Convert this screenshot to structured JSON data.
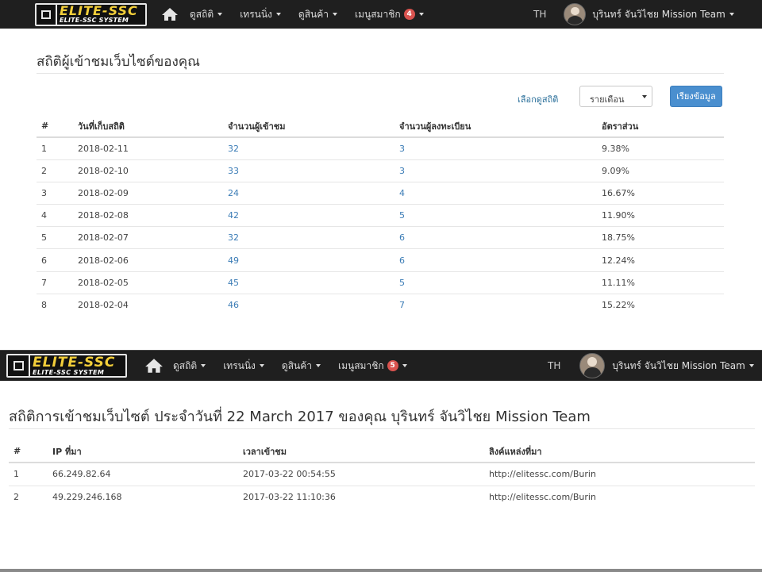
{
  "top": {
    "logo": {
      "brand": "ELITE-SSC",
      "sub": "ELITE-SSC SYSTEM"
    },
    "menu": [
      {
        "label": "ดูสถิติ"
      },
      {
        "label": "เทรนนิ่ง"
      },
      {
        "label": "ดูสินค้า"
      },
      {
        "label": "เมนูสมาชิก",
        "badge": "4"
      }
    ],
    "lang": "TH",
    "user": "บุรินทร์ จันวิไชย Mission Team"
  },
  "stats": {
    "title": "สถิติผู้เข้าชมเว็บไซต์ของคุณ",
    "filter_label": "เลือกดูสถิติ",
    "select_value": "รายเดือน",
    "button_label": "เรียงข้อมูล",
    "headers": [
      "#",
      "วันที่เก็บสถิติ",
      "จำนวนผู้เข้าชม",
      "จำนวนผู้ลงทะเบียน",
      "อัตราส่วน"
    ],
    "rows": [
      [
        "1",
        "2018-02-11",
        "32",
        "3",
        "9.38%"
      ],
      [
        "2",
        "2018-02-10",
        "33",
        "3",
        "9.09%"
      ],
      [
        "3",
        "2018-02-09",
        "24",
        "4",
        "16.67%"
      ],
      [
        "4",
        "2018-02-08",
        "42",
        "5",
        "11.90%"
      ],
      [
        "5",
        "2018-02-07",
        "32",
        "6",
        "18.75%"
      ],
      [
        "6",
        "2018-02-06",
        "49",
        "6",
        "12.24%"
      ],
      [
        "7",
        "2018-02-05",
        "45",
        "5",
        "11.11%"
      ],
      [
        "8",
        "2018-02-04",
        "46",
        "7",
        "15.22%"
      ]
    ]
  },
  "bottom": {
    "logo": {
      "brand": "ELITE-SSC",
      "sub": "ELITE-SSC SYSTEM"
    },
    "menu": [
      {
        "label": "ดูสถิติ"
      },
      {
        "label": "เทรนนิ่ง"
      },
      {
        "label": "ดูสินค้า"
      },
      {
        "label": "เมนูสมาชิก",
        "badge": "5"
      }
    ],
    "lang": "TH",
    "user": "บุรินทร์ จันวิไชย Mission Team"
  },
  "daily": {
    "title": "สถิติการเข้าชมเว็บไซต์ ประจำวันที่ 22 March 2017 ของคุณ บุรินทร์ จันวิไชย Mission Team",
    "headers": [
      "#",
      "IP ที่มา",
      "เวลาเข้าชม",
      "ลิงค์แหล่งที่มา"
    ],
    "rows": [
      [
        "1",
        "66.249.82.64",
        "2017-03-22 00:54:55",
        "http://elitessc.com/Burin"
      ],
      [
        "2",
        "49.229.246.168",
        "2017-03-22 11:10:36",
        "http://elitessc.com/Burin"
      ]
    ]
  },
  "colors": {
    "navbar": "#1f1f1f",
    "link": "#3b7cb6",
    "button": "#4a8fcf",
    "badge": "#d9534f",
    "brand": "#f3cf3a"
  }
}
